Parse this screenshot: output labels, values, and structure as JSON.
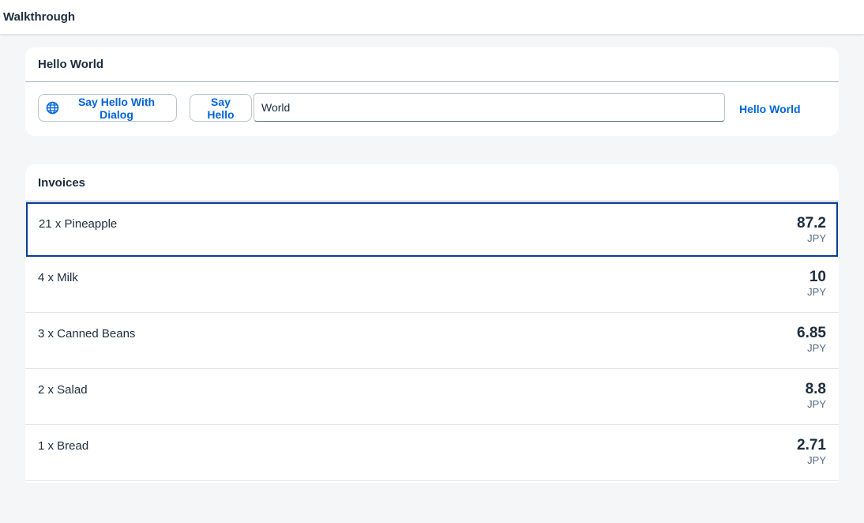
{
  "shell": {
    "title": "Walkthrough"
  },
  "hello_panel": {
    "title": "Hello World",
    "dialog_button_label": "Say Hello With Dialog",
    "dialog_button_icon": "globe-icon",
    "say_hello_label": "Say Hello",
    "input_value": "World",
    "link_text": "Hello World"
  },
  "invoices": {
    "title": "Invoices",
    "items": [
      {
        "title": "21 x Pineapple",
        "value": "87.2",
        "unit": "JPY"
      },
      {
        "title": "4 x Milk",
        "value": "10",
        "unit": "JPY"
      },
      {
        "title": "3 x Canned Beans",
        "value": "6.85",
        "unit": "JPY"
      },
      {
        "title": "2 x Salad",
        "value": "8.8",
        "unit": "JPY"
      },
      {
        "title": "1 x Bread",
        "value": "2.71",
        "unit": "JPY"
      }
    ]
  },
  "colors": {
    "accent": "#0064d9",
    "focus": "#0a3d91",
    "text": "#1d2d3e",
    "background": "#f5f6f7"
  }
}
